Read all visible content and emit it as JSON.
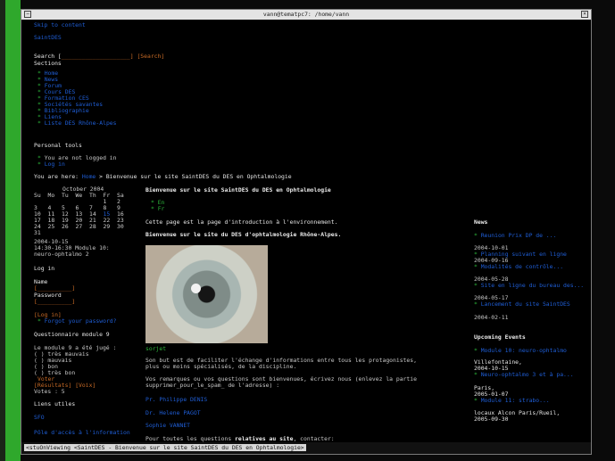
{
  "window": {
    "title": "vann@tematpc7: /home/vann"
  },
  "status_bar": {
    "text": "<stuOnViewing <SaintDES - Bienvenue sur le site SaintDES du DES en Ophtalmologie>"
  },
  "header": {
    "top_link": "Skip to content",
    "site_name": "SaintDES"
  },
  "search": {
    "label": "Search [",
    "field": "____________________]",
    "button": "[Search]"
  },
  "sections": {
    "title": "Sections",
    "items": [
      "Home",
      "News",
      "Forum",
      "Cours DES",
      "Formation CES",
      "Sociétés savantes",
      "Bibliographie",
      "Liens",
      "Liste DES Rhône-Alpes"
    ]
  },
  "personal_tools": {
    "title": "Personal tools",
    "not_logged": "You are not logged in",
    "login_link": "Log in"
  },
  "breadcrumb": {
    "prefix": "You are here:",
    "home": "Home",
    "separator": " > ",
    "current": "Bienvenue sur le site SaintDES du DES en Ophtalmologie"
  },
  "calendar": {
    "month": "October 2004",
    "days": [
      "Su",
      "Mo",
      "Tu",
      "We",
      "Th",
      "Fr",
      "Sa"
    ],
    "weeks": [
      [
        "",
        "",
        "",
        "",
        "",
        "1",
        "2"
      ],
      [
        "3",
        "4",
        "5",
        "6",
        "7",
        "8",
        "9"
      ],
      [
        "10",
        "11",
        "12",
        "13",
        "14",
        "15",
        "16"
      ],
      [
        "17",
        "18",
        "19",
        "20",
        "21",
        "22",
        "23"
      ],
      [
        "24",
        "25",
        "26",
        "27",
        "28",
        "29",
        "30"
      ],
      [
        "31",
        "",
        "",
        "",
        "",
        "",
        ""
      ]
    ],
    "event_date": "2004-10-15",
    "event_line1": "14:30-16:30 Module 10:",
    "event_line2": "neuro-ophtalmo 2"
  },
  "login": {
    "title": "Log in",
    "name_label": "Name",
    "password_label": "Password",
    "field": "[__________]",
    "login_button": "[Log in]",
    "forgot": "Forgot your password?"
  },
  "poll": {
    "title": "Questionnaire module 9",
    "question": "Le module 9 a été jugé :",
    "options": [
      "( ) très mauvais",
      "( ) mauvais",
      "( ) bon",
      "( ) très bon"
    ],
    "vote_button": "Voter",
    "results_button": "[Résultats]",
    "other_button": "[Voix]",
    "votes": "Votes : 5"
  },
  "useful_links": {
    "title": "Liens utiles",
    "item1": "SFO",
    "item2": "Pôle d'accès à l'information"
  },
  "main": {
    "heading": "Bienvenue sur le site SaintDES du DES en Ophtalmologie",
    "lang1": "En",
    "lang2": "Fr",
    "intro": "Cette page est la page d'introduction à l'environnement.",
    "subtitle": "Bienvenue sur le site du DES d'ophtalmologie Rhône-Alpes.",
    "image_caption": "sorjet",
    "para1_line1": "Son but est de faciliter l'échange d'informations entre tous les protagonistes,",
    "para1_line2": "plus ou moins spécialisés, de la discipline.",
    "para2_line1": "Vos remarques ou vos questions sont bienvenues, écrivez nous (enlevez la partie",
    "para2_line2": "supprimer_pour_le_spam_ de l'adresse) :",
    "contact1": "Pr. Philippe DENIS",
    "contact2": "Dr. Helene PAGOT",
    "contact3": "Sophie VANNET",
    "contact_line_a": "Pour toutes les questions ",
    "contact_line_b": "relatives au site",
    "contact_line_c": ", contacter:"
  },
  "news": {
    "title": "News",
    "items": [
      {
        "link": "Reunion Prix DP de ...",
        "date": "2004-10-01"
      },
      {
        "link": "Planning suivant en ligne",
        "date": "2004-09-16"
      },
      {
        "link": "Modalités de contrôle...",
        "date": "2004-05-28"
      },
      {
        "link": "Site en ligne du bureau des...",
        "date": "2004-05-17"
      },
      {
        "link": "Lancement du site SaintDES",
        "date": "2004-02-11"
      }
    ]
  },
  "upcoming": {
    "title": "Upcoming Events",
    "items": [
      {
        "link": "Module 10: neuro-ophtalmo",
        "place": "Villefontaine,",
        "date": "2004-10-15"
      },
      {
        "link": "Neuro-ophtalmo 3 et à pa...",
        "place": "Paris,",
        "date": "2005-01-07"
      },
      {
        "link": "Module 11: strabo...",
        "place": "locaux Alcon Paris/Rueil,",
        "date": "2005-09-30"
      }
    ]
  }
}
